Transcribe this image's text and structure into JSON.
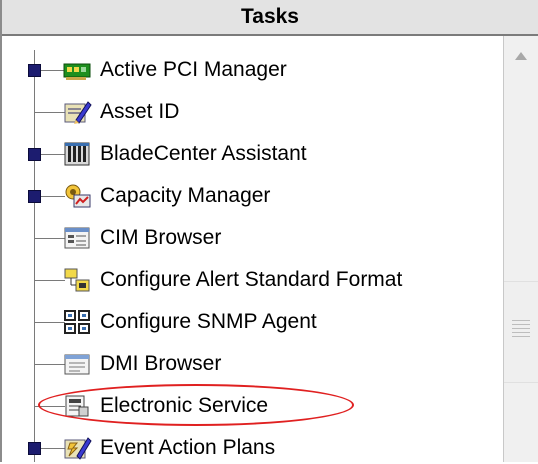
{
  "panel": {
    "title": "Tasks"
  },
  "tasks": [
    {
      "label": "Active PCI Manager",
      "icon": "pci-card-icon",
      "expandable": true
    },
    {
      "label": "Asset ID",
      "icon": "asset-id-icon",
      "expandable": false
    },
    {
      "label": "BladeCenter Assistant",
      "icon": "bladecenter-icon",
      "expandable": true
    },
    {
      "label": "Capacity Manager",
      "icon": "capacity-manager-icon",
      "expandable": true
    },
    {
      "label": "CIM Browser",
      "icon": "cim-browser-icon",
      "expandable": false
    },
    {
      "label": "Configure Alert Standard Format",
      "icon": "alert-format-icon",
      "expandable": false
    },
    {
      "label": "Configure SNMP Agent",
      "icon": "snmp-agent-icon",
      "expandable": false
    },
    {
      "label": "DMI Browser",
      "icon": "dmi-browser-icon",
      "expandable": false
    },
    {
      "label": "Electronic Service",
      "icon": "electronic-service-icon",
      "expandable": false,
      "highlighted": true
    },
    {
      "label": "Event Action Plans",
      "icon": "event-action-plans-icon",
      "expandable": true
    }
  ],
  "colors": {
    "highlight": "#e02020",
    "expander": "#1c1c6f",
    "header_bg": "#e3e3e3"
  }
}
